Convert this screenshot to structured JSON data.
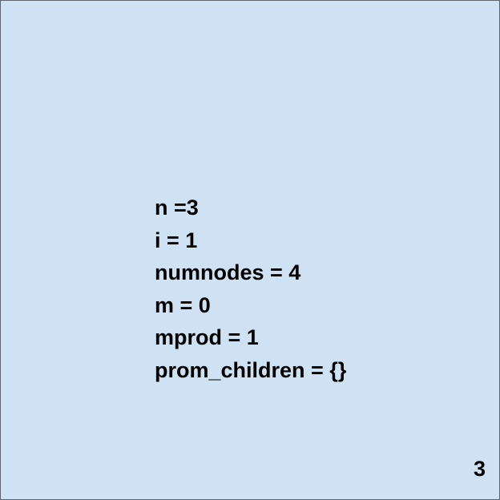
{
  "slide": {
    "background_color": "#cfe2f3",
    "lines": [
      "n =3",
      "i = 1",
      "numnodes = 4",
      "m = 0",
      "mprod = 1",
      "prom_children = {}"
    ],
    "page_number": "3"
  }
}
